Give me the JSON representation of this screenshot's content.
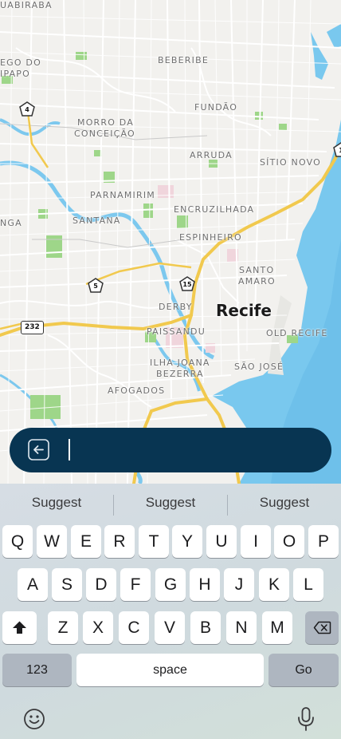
{
  "map": {
    "city": "Recife",
    "places": [
      "UABIRABA",
      "EGO DO",
      "IPAPO",
      "BEBERIBE",
      "FUNDÃO",
      "MORRO DA",
      "CONCEIÇÃO",
      "ARRUDA",
      "SÍTIO NOVO",
      "PARNAMIRIM",
      "ENCRUZILHADA",
      "SANTANA",
      "NGA",
      "ESPINHEIRO",
      "SANTO",
      "AMARO",
      "DERBY",
      "PAISSANDU",
      "OLD RECIFE",
      "ILHA JOANA",
      "BEZERRA",
      "SÃO JOSÉ",
      "AFOGADOS"
    ],
    "road_shields": [
      "4",
      "5",
      "15",
      "1"
    ],
    "road_badge": "232"
  },
  "search": {
    "value": ""
  },
  "keyboard": {
    "suggestions": [
      "Suggest",
      "Suggest",
      "Suggest"
    ],
    "row1": [
      "Q",
      "W",
      "E",
      "R",
      "T",
      "Y",
      "U",
      "I",
      "O",
      "P"
    ],
    "row2": [
      "A",
      "S",
      "D",
      "F",
      "G",
      "H",
      "J",
      "K",
      "L"
    ],
    "row3": [
      "Z",
      "X",
      "C",
      "V",
      "B",
      "N",
      "M"
    ],
    "numbers_label": "123",
    "space_label": "space",
    "go_label": "Go",
    "icons": [
      "shift-icon",
      "delete-icon",
      "emoji-icon",
      "microphone-icon",
      "back-arrow-icon"
    ]
  }
}
